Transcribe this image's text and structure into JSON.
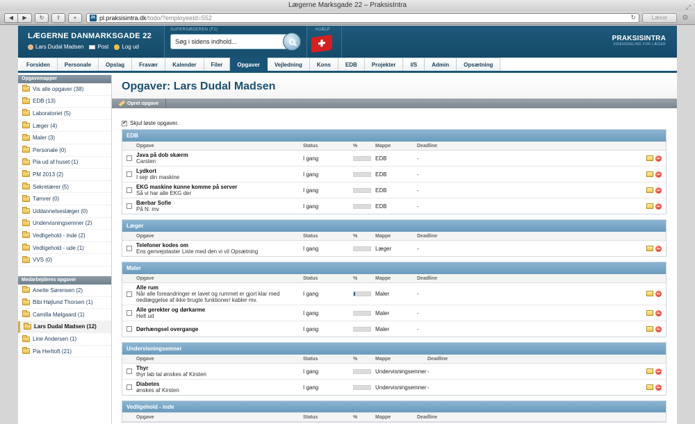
{
  "browser": {
    "title": "Lægerne Marksgade 22 – PraksisIntra",
    "url_host": "pl.praksisintra.dk",
    "url_path": "/todo/?employeeId=552",
    "favicon": "PI",
    "reader_label": "Læser"
  },
  "header": {
    "brand": "LÆGERNE DANMARKSGADE 22",
    "user": "Lars Dudal Madsen",
    "post": "Post",
    "logout": "Log ud",
    "search_label": "SUPERSØGEREN (F2)",
    "search_placeholder": "Søg i sidens indhold...",
    "help_label": "HJÆLP",
    "logo_main": "PRAKSISINTRA",
    "logo_sub": "VIDENSDELING FOR LÆGER"
  },
  "tabs": [
    {
      "label": "Forsiden",
      "active": false
    },
    {
      "label": "Personale",
      "active": false
    },
    {
      "label": "Opslag",
      "active": false
    },
    {
      "label": "Fravær",
      "active": false
    },
    {
      "label": "Kalender",
      "active": false
    },
    {
      "label": "Filer",
      "active": false
    },
    {
      "label": "Opgaver",
      "active": true
    },
    {
      "label": "Vejledning",
      "active": false
    },
    {
      "label": "Kons",
      "active": false
    },
    {
      "label": "EDB",
      "active": false
    },
    {
      "label": "Projekter",
      "active": false
    },
    {
      "label": "I/S",
      "active": false
    },
    {
      "label": "Admin",
      "active": false
    },
    {
      "label": "Opsætning",
      "active": false
    }
  ],
  "sidebar": {
    "folders_head": "Opgavemapper",
    "folders": [
      "Vis alle opgaver (38)",
      "EDB (13)",
      "Laboratoriet (5)",
      "Læger (4)",
      "Maler (3)",
      "Personale (0)",
      "Pia ud af huset (1)",
      "PM 2013 (2)",
      "Sekretærer (5)",
      "Tømrer (0)",
      "Uddannelseslæger (0)",
      "Undervisningsemner (2)",
      "Vedligehold - inde (2)",
      "Vedligehold - ude (1)",
      "VVS (0)"
    ],
    "staff_head": "Medarbejderes opgaver",
    "staff": [
      {
        "label": "Anette Sørensen (2)",
        "active": false
      },
      {
        "label": "Bibi Højlund Thorsen (1)",
        "active": false
      },
      {
        "label": "Camilla Mølgaard (1)",
        "active": false
      },
      {
        "label": "Lars Dudal Madsen (12)",
        "active": true
      },
      {
        "label": "Line Andersen (1)",
        "active": false
      },
      {
        "label": "Pia Herltoft (21)",
        "active": false
      }
    ]
  },
  "main": {
    "title": "Opgaver: Lars Dudal Madsen",
    "create_button": "Opret opgave",
    "hide_solved": "Skjul løste opgaver.",
    "hide_solved_checked": true,
    "columns": {
      "task": "Opgave",
      "status": "Status",
      "pct": "%",
      "folder": "Mappe",
      "deadline": "Deadline"
    },
    "groups": [
      {
        "name": "EDB",
        "rows": [
          {
            "title": "Java på dob skærm",
            "desc": "Carsten",
            "status": "I gang",
            "pct": 0,
            "folder": "EDB",
            "deadline": "-"
          },
          {
            "title": "Lydkort",
            "desc": "I sejr din maskine",
            "status": "I gang",
            "pct": 0,
            "folder": "EDB",
            "deadline": "-"
          },
          {
            "title": "EKG maskine kunne komme på server",
            "desc": "Så vi har alle EKG der",
            "status": "I gang",
            "pct": 0,
            "folder": "EDB",
            "deadline": "-"
          },
          {
            "title": "Bærbar Sofie",
            "desc": "På N: mv",
            "status": "I gang",
            "pct": 0,
            "folder": "EDB",
            "deadline": "-"
          }
        ]
      },
      {
        "name": "Læger",
        "rows": [
          {
            "title": "Telefoner kodes om",
            "desc": "Ens genvejstaster Liste med den vi vil Opsætning",
            "status": "I gang",
            "pct": 0,
            "folder": "Læger",
            "deadline": "-"
          }
        ]
      },
      {
        "name": "Maler",
        "rows": [
          {
            "title": "Alle rum",
            "desc": "Når alle foreandringer er lavet og rummet er gjort klar med nedlæggelse af ikke brugte funktioner/ kabler mv.",
            "status": "I gang",
            "pct": 10,
            "folder": "Maler",
            "deadline": "-"
          },
          {
            "title": "Alle gerekter og dørkarme",
            "desc": "Helt ud",
            "status": "I gang",
            "pct": 0,
            "folder": "Maler",
            "deadline": "-"
          },
          {
            "title": "Dørhængsel overgange",
            "desc": "",
            "status": "I gang",
            "pct": 0,
            "folder": "Maler",
            "deadline": "-"
          }
        ]
      },
      {
        "name": "Undervisningsemner",
        "rows": [
          {
            "title": "Thyr",
            "desc": "thyr lab tal ønskes af Kirsten",
            "status": "I gang",
            "pct": 0,
            "folder": "Undervisningsemner",
            "deadline": "-"
          },
          {
            "title": "Diabetes",
            "desc": "ønskes af Kirsten",
            "status": "I gang",
            "pct": 0,
            "folder": "Undervisningsemner",
            "deadline": "-"
          }
        ]
      },
      {
        "name": "Vedligehold - inde",
        "rows": []
      }
    ]
  }
}
